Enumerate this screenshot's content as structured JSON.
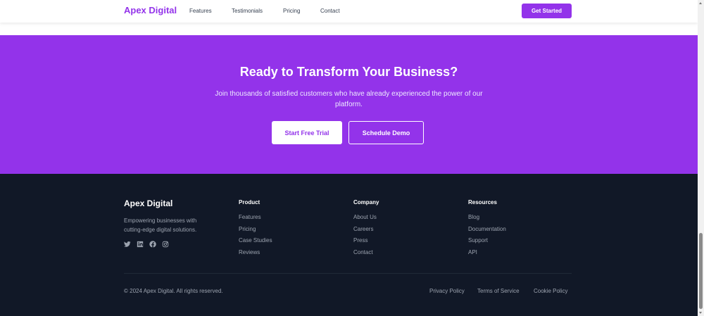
{
  "header": {
    "brand": "Apex Digital",
    "nav": [
      "Features",
      "Testimonials",
      "Pricing",
      "Contact"
    ],
    "cta_label": "Get Started"
  },
  "cta": {
    "title": "Ready to Transform Your Business?",
    "subtitle": "Join thousands of satisfied customers who have already experienced the power of our platform.",
    "primary_label": "Start Free Trial",
    "secondary_label": "Schedule Demo"
  },
  "footer": {
    "brand": "Apex Digital",
    "tagline": "Empowering businesses with cutting-edge digital solutions.",
    "social_icons": [
      "twitter-icon",
      "linkedin-icon",
      "facebook-icon",
      "instagram-icon"
    ],
    "columns": [
      {
        "heading": "Product",
        "links": [
          "Features",
          "Pricing",
          "Case Studies",
          "Reviews"
        ]
      },
      {
        "heading": "Company",
        "links": [
          "About Us",
          "Careers",
          "Press",
          "Contact"
        ]
      },
      {
        "heading": "Resources",
        "links": [
          "Blog",
          "Documentation",
          "Support",
          "API"
        ]
      }
    ],
    "copyright": "© 2024 Apex Digital. All rights reserved.",
    "legal_links": [
      "Privacy Policy",
      "Terms of Service",
      "Cookie Policy"
    ]
  },
  "colors": {
    "brand": "#9333ea",
    "footer_bg": "#111827",
    "muted_text": "#9ca3af"
  }
}
